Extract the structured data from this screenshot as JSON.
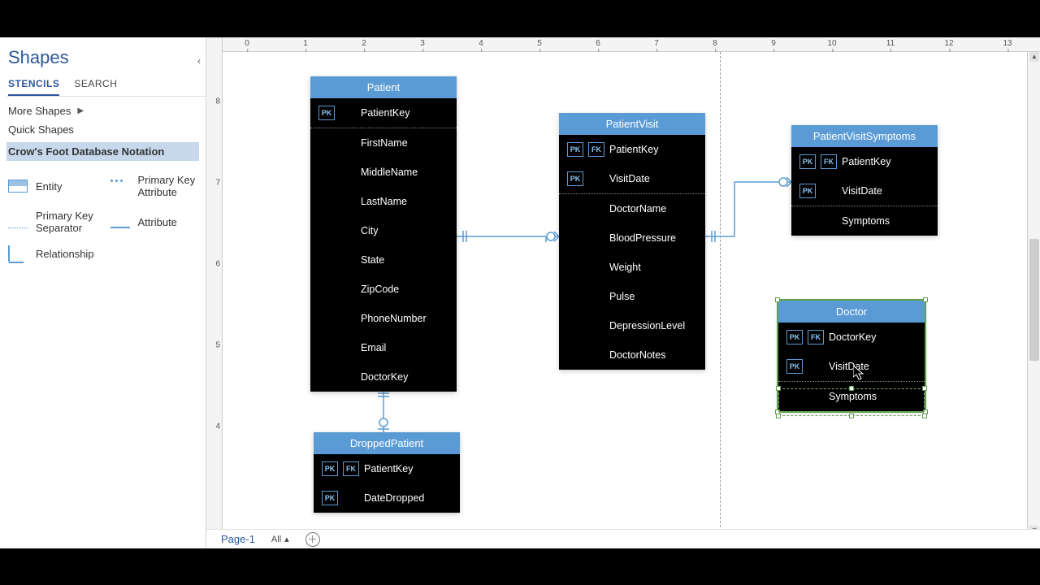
{
  "pane": {
    "title": "Shapes",
    "tab_stencils": "STENCILS",
    "tab_search": "SEARCH",
    "more": "More Shapes",
    "quick": "Quick Shapes",
    "stencil_name": "Crow's Foot Database Notation",
    "shapes": {
      "entity": "Entity",
      "pka": "Primary Key Attribute",
      "pks": "Primary Key Separator",
      "attr": "Attribute",
      "rel": "Relationship"
    }
  },
  "entities": {
    "patient": {
      "title": "Patient",
      "rows": [
        {
          "pk": true,
          "fk": false,
          "name": "PatientKey",
          "sep": true
        },
        {
          "pk": false,
          "fk": false,
          "name": "FirstName"
        },
        {
          "pk": false,
          "fk": false,
          "name": "MiddleName"
        },
        {
          "pk": false,
          "fk": false,
          "name": "LastName"
        },
        {
          "pk": false,
          "fk": false,
          "name": "City"
        },
        {
          "pk": false,
          "fk": false,
          "name": "State"
        },
        {
          "pk": false,
          "fk": false,
          "name": "ZipCode"
        },
        {
          "pk": false,
          "fk": false,
          "name": "PhoneNumber"
        },
        {
          "pk": false,
          "fk": false,
          "name": "Email"
        },
        {
          "pk": false,
          "fk": false,
          "name": "DoctorKey"
        }
      ]
    },
    "visit": {
      "title": "PatientVisit",
      "rows": [
        {
          "pk": true,
          "fk": true,
          "name": "PatientKey"
        },
        {
          "pk": true,
          "fk": false,
          "name": "VisitDate",
          "sep": true
        },
        {
          "pk": false,
          "fk": false,
          "name": "DoctorName"
        },
        {
          "pk": false,
          "fk": false,
          "name": "BloodPressure"
        },
        {
          "pk": false,
          "fk": false,
          "name": "Weight"
        },
        {
          "pk": false,
          "fk": false,
          "name": "Pulse"
        },
        {
          "pk": false,
          "fk": false,
          "name": "DepressionLevel"
        },
        {
          "pk": false,
          "fk": false,
          "name": "DoctorNotes"
        }
      ]
    },
    "symptoms": {
      "title": "PatientVisitSymptoms",
      "rows": [
        {
          "pk": true,
          "fk": true,
          "name": "PatientKey"
        },
        {
          "pk": true,
          "fk": false,
          "name": "VisitDate",
          "sep": true
        },
        {
          "pk": false,
          "fk": false,
          "name": "Symptoms"
        }
      ]
    },
    "doctor": {
      "title": "Doctor",
      "rows": [
        {
          "pk": true,
          "fk": true,
          "name": "DoctorKey"
        },
        {
          "pk": true,
          "fk": false,
          "name": "VisitDate",
          "sep": true
        },
        {
          "pk": false,
          "fk": false,
          "name": "Symptoms"
        }
      ]
    },
    "dropped": {
      "title": "DroppedPatient",
      "rows": [
        {
          "pk": true,
          "fk": true,
          "name": "PatientKey"
        },
        {
          "pk": true,
          "fk": false,
          "name": "DateDropped"
        }
      ]
    }
  },
  "status": {
    "page": "Page-1",
    "all": "All"
  },
  "ruler_h": [
    "0",
    "1",
    "2",
    "3",
    "4",
    "5",
    "6",
    "7",
    "8",
    "9",
    "10",
    "11",
    "12",
    "13"
  ],
  "ruler_v": [
    "8",
    "7",
    "6",
    "5",
    "4"
  ],
  "chart_data": {
    "type": "diagram",
    "notation": "Crow's Foot ERD",
    "entities": [
      {
        "name": "Patient",
        "pk": [
          "PatientKey"
        ],
        "attrs": [
          "FirstName",
          "MiddleName",
          "LastName",
          "City",
          "State",
          "ZipCode",
          "PhoneNumber",
          "Email",
          "DoctorKey"
        ]
      },
      {
        "name": "PatientVisit",
        "pk": [
          "PatientKey",
          "VisitDate"
        ],
        "fk": [
          "PatientKey"
        ],
        "attrs": [
          "DoctorName",
          "BloodPressure",
          "Weight",
          "Pulse",
          "DepressionLevel",
          "DoctorNotes"
        ]
      },
      {
        "name": "PatientVisitSymptoms",
        "pk": [
          "PatientKey",
          "VisitDate"
        ],
        "fk": [
          "PatientKey"
        ],
        "attrs": [
          "Symptoms"
        ]
      },
      {
        "name": "DroppedPatient",
        "pk": [
          "PatientKey",
          "DateDropped"
        ],
        "fk": [
          "PatientKey"
        ]
      },
      {
        "name": "Doctor",
        "pk": [
          "DoctorKey",
          "VisitDate"
        ],
        "fk": [
          "DoctorKey"
        ],
        "attrs": [
          "Symptoms"
        ]
      }
    ],
    "relationships": [
      {
        "from": "Patient",
        "to": "PatientVisit",
        "cardinality": "1-to-many"
      },
      {
        "from": "PatientVisit",
        "to": "PatientVisitSymptoms",
        "cardinality": "1-to-many"
      },
      {
        "from": "Patient",
        "to": "DroppedPatient",
        "cardinality": "1-to-0or1"
      }
    ]
  }
}
